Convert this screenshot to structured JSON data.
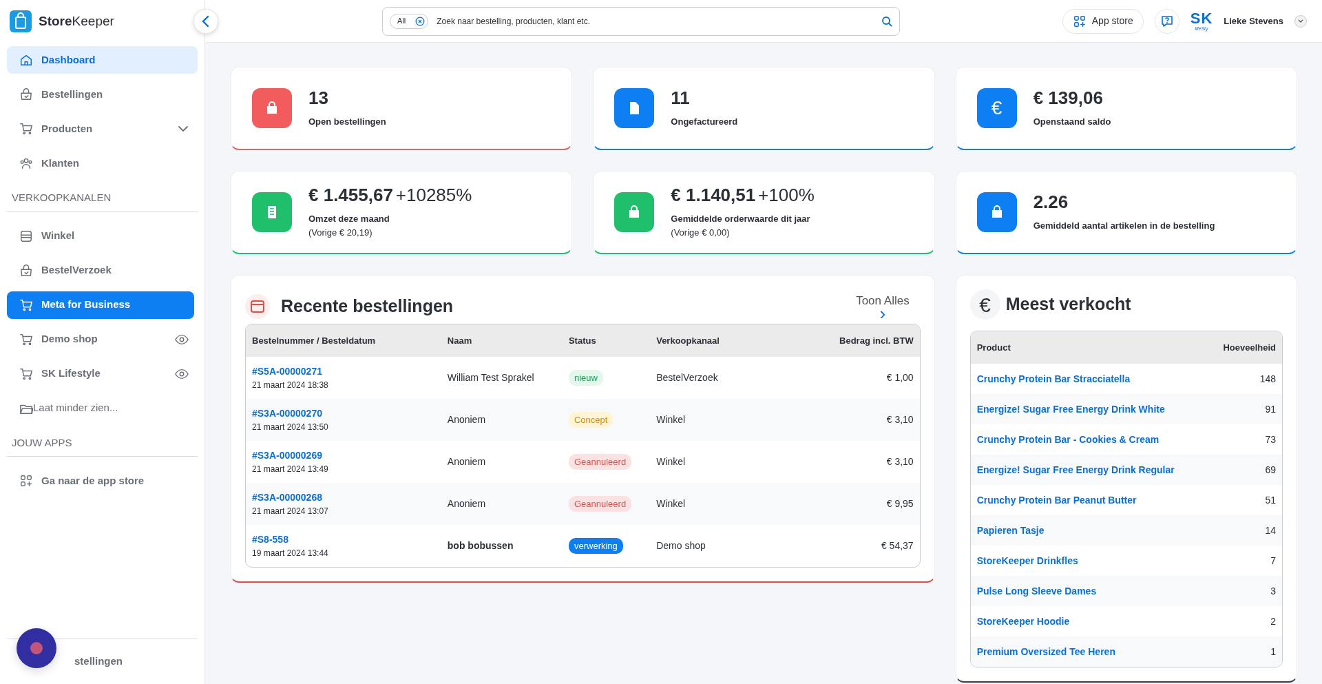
{
  "brand": {
    "bold": "Store",
    "light": "Keeper"
  },
  "search": {
    "scope": "All",
    "placeholder": "Zoek naar bestelling, producten, klant etc."
  },
  "header": {
    "app_store": "App store",
    "logo_main": "SK",
    "logo_sub": "lifeSty",
    "user": "Lieke Stevens"
  },
  "sidebar": {
    "main": [
      {
        "label": "Dashboard",
        "selected": true,
        "active": false,
        "kind": "link"
      },
      {
        "label": "Bestellingen",
        "selected": false,
        "active": false,
        "kind": "link"
      },
      {
        "label": "Producten",
        "selected": false,
        "active": false,
        "kind": "group",
        "expanded": false
      },
      {
        "label": "Klanten",
        "selected": false,
        "active": false,
        "kind": "link"
      }
    ],
    "sections": [
      {
        "title": "VERKOOPKANALEN",
        "items": [
          {
            "label": "Winkel",
            "selected": false,
            "active": false,
            "kind": "link"
          },
          {
            "label": "BestelVerzoek",
            "selected": false,
            "active": false,
            "kind": "link"
          },
          {
            "label": "Meta for Business",
            "selected": false,
            "active": true,
            "kind": "link"
          },
          {
            "label": "Demo shop",
            "selected": false,
            "active": false,
            "kind": "shop"
          },
          {
            "label": "SK Lifestyle",
            "selected": false,
            "active": false,
            "kind": "shop"
          },
          {
            "label": "Laat minder zien...",
            "selected": false,
            "active": false,
            "kind": "toggle"
          }
        ]
      },
      {
        "title": "JOUW APPS",
        "items": [
          {
            "label": "Ga naar de app store",
            "selected": false,
            "active": false,
            "kind": "link"
          }
        ]
      }
    ],
    "footer": {
      "label": "stellingen"
    }
  },
  "stats": [
    {
      "value": "13",
      "label": "Open bestellingen",
      "color": "#f25c5c"
    },
    {
      "value": "11",
      "label": "Ongefactureerd",
      "color": "#0d7ff2"
    },
    {
      "value": "€ 139,06",
      "label": "Openstaand saldo",
      "color": "#0d7ff2",
      "icon_text": "€"
    },
    {
      "value": "€ 1.455,67",
      "change": "+10285%",
      "label": "Omzet deze maand",
      "note": "(Vorige € 20,19)",
      "color": "#1fbf6b"
    },
    {
      "value": "€ 1.140,51",
      "change": "+100%",
      "label": "Gemiddelde orderwaarde dit jaar",
      "note": "(Vorige € 0,00)",
      "color": "#1fbf6b"
    },
    {
      "value": "2.26",
      "label": "Gemiddeld aantal artikelen in de bestelling",
      "color": "#0d7ff2"
    }
  ],
  "recent": {
    "title": "Recente bestellingen",
    "link": "Toon Alles",
    "link_arrow": "›",
    "columns": [
      "Bestelnummer / Besteldatum",
      "Naam",
      "Status",
      "Verkoopkanaal",
      "Bedrag incl. BTW"
    ],
    "rows": [
      {
        "number": "#S5A-00000271",
        "date": "21 maart 2024 18:38",
        "name": "William Test Sprakel",
        "status": "nieuw",
        "kind": "new",
        "channel": "BestelVerzoek",
        "amount": "€ 1,00"
      },
      {
        "number": "#S3A-00000270",
        "date": "21 maart 2024 13:50",
        "name": "Anoniem",
        "status": "Concept",
        "kind": "concept",
        "channel": "Winkel",
        "amount": "€ 3,10"
      },
      {
        "number": "#S3A-00000269",
        "date": "21 maart 2024 13:49",
        "name": "Anoniem",
        "status": "Geannuleerd",
        "kind": "cancelled",
        "channel": "Winkel",
        "amount": "€ 3,10"
      },
      {
        "number": "#S3A-00000268",
        "date": "21 maart 2024 13:07",
        "name": "Anoniem",
        "status": "Geannuleerd",
        "kind": "cancelled",
        "channel": "Winkel",
        "amount": "€ 9,95"
      },
      {
        "number": "#S8-558",
        "date": "19 maart 2024 13:44",
        "name": "bob bobussen",
        "status": "verwerking",
        "kind": "processing",
        "channel": "Demo shop",
        "amount": "€ 54,37"
      }
    ]
  },
  "best": {
    "title": "Meest verkocht",
    "icon_text": "€",
    "columns": [
      "Product",
      "Hoeveelheid"
    ],
    "rows": [
      {
        "product": "Crunchy Protein Bar Stracciatella",
        "qty": "148"
      },
      {
        "product": "Energize! Sugar Free Energy Drink White",
        "qty": "91"
      },
      {
        "product": "Crunchy Protein Bar - Cookies & Cream",
        "qty": "73"
      },
      {
        "product": "Energize! Sugar Free Energy Drink Regular",
        "qty": "69"
      },
      {
        "product": "Crunchy Protein Bar Peanut Butter",
        "qty": "51"
      },
      {
        "product": "Papieren Tasje",
        "qty": "14"
      },
      {
        "product": "StoreKeeper Drinkfles",
        "qty": "7"
      },
      {
        "product": "Pulse Long Sleeve Dames",
        "qty": "3"
      },
      {
        "product": "StoreKeeper Hoodie",
        "qty": "2"
      },
      {
        "product": "Premium Oversized Tee Heren",
        "qty": "1"
      }
    ]
  }
}
